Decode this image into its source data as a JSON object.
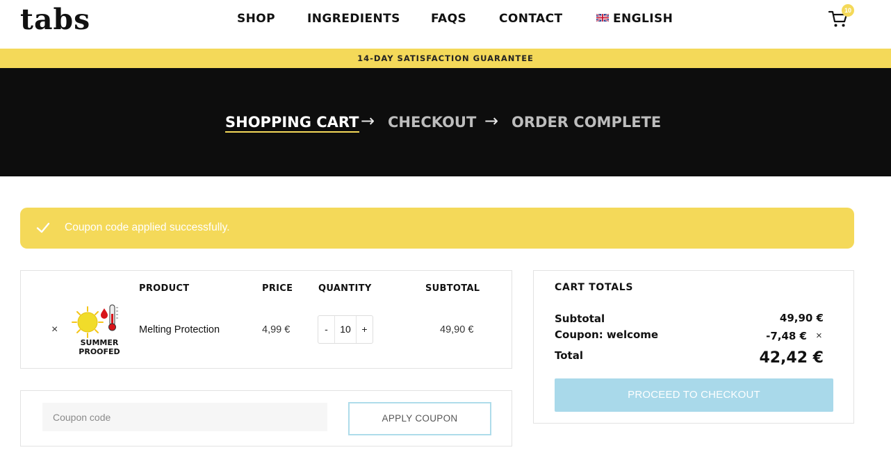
{
  "header": {
    "logo": "tabs",
    "nav": [
      "SHOP",
      "INGREDIENTS",
      "FAQS",
      "CONTACT"
    ],
    "language": "ENGLISH",
    "cart_count": "10"
  },
  "guarantee": "14-DAY SATISFACTION GUARANTEE",
  "steps": {
    "shopping_cart": "SHOPPING CART",
    "arrow": "→",
    "checkout": "CHECKOUT",
    "order_complete": "ORDER COMPLETE"
  },
  "notice": {
    "message": "Coupon code applied successfully."
  },
  "cart_table": {
    "headers": {
      "product": "PRODUCT",
      "price": "PRICE",
      "quantity": "QUANTITY",
      "subtotal": "SUBTOTAL"
    },
    "row": {
      "remove": "×",
      "thumb_text": [
        "SUMMER",
        "PROOFED"
      ],
      "name": "Melting Protection",
      "price": "4,99 €",
      "qty_minus": "-",
      "quantity": "10",
      "qty_plus": "+",
      "subtotal": "49,90 €"
    }
  },
  "coupon": {
    "placeholder": "Coupon code",
    "apply_label": "APPLY COUPON"
  },
  "totals": {
    "title": "CART TOTALS",
    "subtotal_label": "Subtotal",
    "subtotal_value": "49,90 €",
    "coupon_label": "Coupon: welcome",
    "coupon_value": "-7,48 €",
    "coupon_remove": "×",
    "total_label": "Total",
    "total_value": "42,42 €",
    "checkout_label": "PROCEED TO CHECKOUT"
  },
  "colors": {
    "accent_yellow": "#f4d959",
    "hero_bg": "#0d0d0d",
    "checkout_blue": "#a9d9ea"
  }
}
